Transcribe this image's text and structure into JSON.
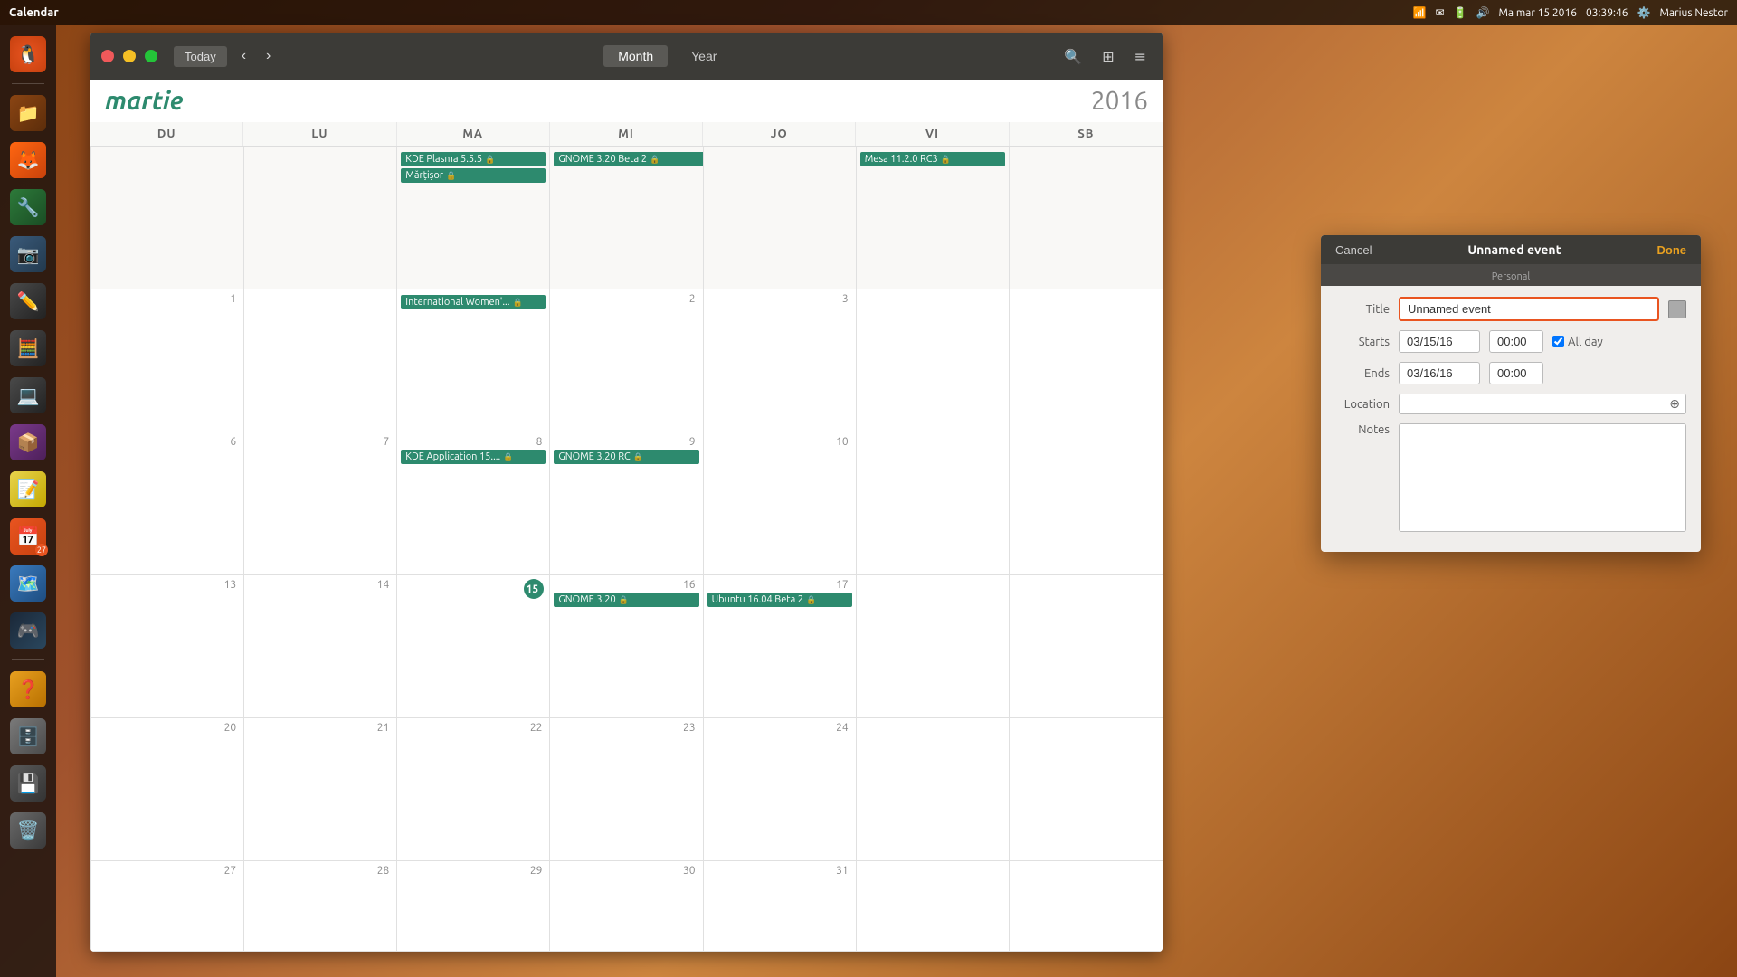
{
  "system": {
    "title": "Calendar",
    "time": "03:39:46",
    "date": "Ma mar 15 2016",
    "user": "Marius Nestor",
    "battery_icon": "🔋",
    "wifi_icon": "📶",
    "sound_icon": "🔊"
  },
  "titlebar": {
    "close_label": "",
    "min_label": "",
    "max_label": "",
    "today_label": "Today",
    "view_month": "Month",
    "view_year": "Year"
  },
  "calendar": {
    "month": "martie",
    "year": "2016",
    "day_headers": [
      "DU",
      "LU",
      "MA",
      "MI",
      "JO",
      "VI",
      "SB"
    ],
    "weeks": [
      {
        "days": [
          {
            "num": "",
            "events": [
              {
                "label": "KDE Plasma 5.5.5",
                "icons": "🔒"
              },
              {
                "label": "Mărțișor",
                "icons": "🔒"
              }
            ]
          },
          {
            "num": "",
            "events": []
          },
          {
            "num": "",
            "events": [
              {
                "label": "GNOME 3.20 Beta 2",
                "icons": "🔒"
              }
            ]
          },
          {
            "num": "",
            "events": []
          },
          {
            "num": "",
            "events": []
          },
          {
            "num": "",
            "events": [
              {
                "label": "Mesa 11.2.0 RC3",
                "icons": "🔒"
              }
            ]
          },
          {
            "num": "",
            "events": []
          }
        ]
      },
      {
        "days": [
          {
            "num": "1",
            "events": []
          },
          {
            "num": "",
            "events": []
          },
          {
            "num": "",
            "events": [
              {
                "label": "International Women'...",
                "icons": "🔒"
              }
            ]
          },
          {
            "num": "2",
            "events": []
          },
          {
            "num": "3",
            "events": []
          },
          {
            "num": "",
            "events": []
          },
          {
            "num": "",
            "events": []
          }
        ]
      },
      {
        "days": [
          {
            "num": "6",
            "events": []
          },
          {
            "num": "7",
            "events": []
          },
          {
            "num": "8",
            "events": [
              {
                "label": "KDE Application 15....",
                "icons": "🔒"
              }
            ]
          },
          {
            "num": "9",
            "events": [
              {
                "label": "GNOME 3.20 RC",
                "icons": "🔒"
              }
            ]
          },
          {
            "num": "10",
            "events": []
          },
          {
            "num": "",
            "events": []
          },
          {
            "num": "",
            "events": []
          }
        ]
      },
      {
        "days": [
          {
            "num": "13",
            "events": []
          },
          {
            "num": "14",
            "events": []
          },
          {
            "num": "15",
            "events": [],
            "today": true
          },
          {
            "num": "16",
            "events": [
              {
                "label": "GNOME 3.20",
                "icons": "🔒"
              }
            ]
          },
          {
            "num": "17",
            "events": [
              {
                "label": "Ubuntu 16.04 Beta 2",
                "icons": "🔒"
              }
            ]
          },
          {
            "num": "",
            "events": []
          },
          {
            "num": "",
            "events": []
          }
        ]
      },
      {
        "days": [
          {
            "num": "20",
            "events": []
          },
          {
            "num": "21",
            "events": []
          },
          {
            "num": "22",
            "events": []
          },
          {
            "num": "23",
            "events": []
          },
          {
            "num": "24",
            "events": []
          },
          {
            "num": "",
            "events": []
          },
          {
            "num": "",
            "events": []
          }
        ]
      },
      {
        "days": [
          {
            "num": "27",
            "events": []
          },
          {
            "num": "28",
            "events": []
          },
          {
            "num": "29",
            "events": []
          },
          {
            "num": "30",
            "events": []
          },
          {
            "num": "31",
            "events": []
          },
          {
            "num": "",
            "events": []
          },
          {
            "num": "",
            "events": []
          }
        ]
      }
    ]
  },
  "dialog": {
    "title": "Unnamed event",
    "subtitle": "Personal",
    "cancel_label": "Cancel",
    "done_label": "Done",
    "fields": {
      "title_label": "Title",
      "title_value": "Unnamed event",
      "starts_label": "Starts",
      "starts_date": "03/15/16",
      "starts_time": "00:00",
      "allday_label": "All day",
      "ends_label": "Ends",
      "ends_date": "03/16/16",
      "ends_time": "00:00",
      "location_label": "Location",
      "location_value": "",
      "location_placeholder": "",
      "notes_label": "Notes",
      "notes_value": ""
    }
  },
  "dock": {
    "items": [
      {
        "icon": "🐧",
        "label": "Ubuntu",
        "name": "ubuntu-icon"
      },
      {
        "icon": "📁",
        "label": "Files",
        "name": "files-icon"
      },
      {
        "icon": "🦊",
        "label": "Firefox",
        "name": "firefox-icon"
      },
      {
        "icon": "🔧",
        "label": "Tools",
        "name": "tools-icon"
      },
      {
        "icon": "📷",
        "label": "Shotwell",
        "name": "shotwell-icon"
      },
      {
        "icon": "✏️",
        "label": "Editor",
        "name": "editor-icon"
      },
      {
        "icon": "🧮",
        "label": "Calculator",
        "name": "calculator-icon"
      },
      {
        "icon": "💻",
        "label": "Terminal",
        "name": "terminal-icon"
      },
      {
        "icon": "📦",
        "label": "Software",
        "name": "software-icon"
      },
      {
        "icon": "📝",
        "label": "Notes",
        "name": "notes-icon"
      },
      {
        "icon": "📅",
        "label": "Calendar",
        "name": "calendar-icon"
      },
      {
        "icon": "🗺️",
        "label": "Maps",
        "name": "maps-icon"
      },
      {
        "icon": "🎮",
        "label": "Steam",
        "name": "steam-icon"
      },
      {
        "icon": "❓",
        "label": "Help",
        "name": "help-icon"
      },
      {
        "icon": "🗄️",
        "label": "Files2",
        "name": "files2-icon"
      },
      {
        "icon": "💾",
        "label": "Disk",
        "name": "disk-icon"
      },
      {
        "icon": "🗑️",
        "label": "Trash",
        "name": "trash-icon"
      }
    ]
  }
}
